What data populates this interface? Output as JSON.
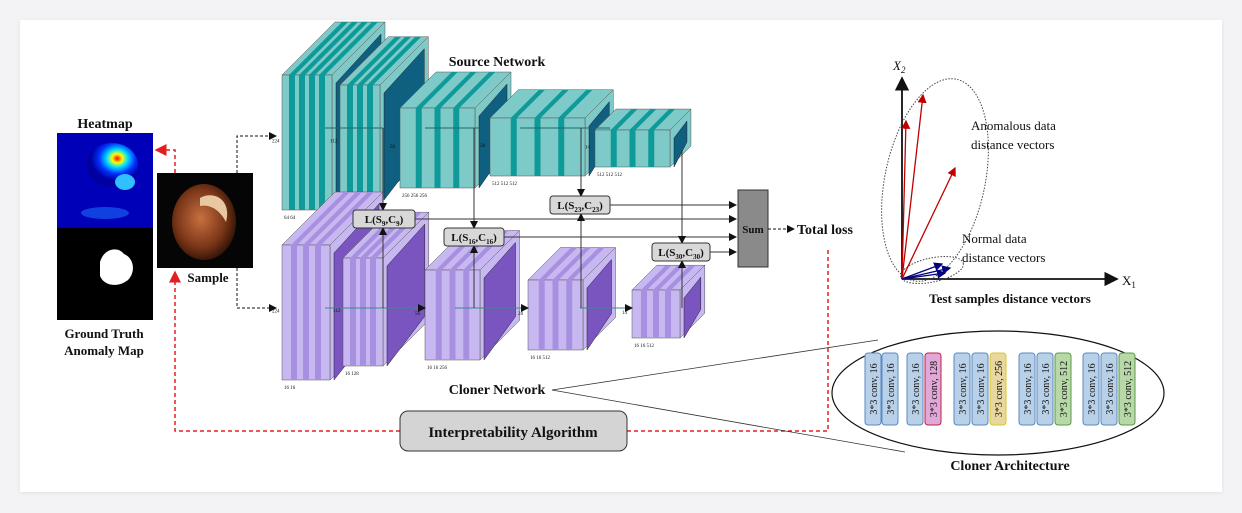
{
  "labels": {
    "heatmap": "Heatmap",
    "ground_truth_1": "Ground Truth",
    "ground_truth_2": "Anomaly Map",
    "sample": "Sample",
    "source_network": "Source Network",
    "cloner_network": "Cloner Network",
    "sum": "Sum",
    "total_loss": "Total loss",
    "interpretability": "Interpretability Algorithm",
    "cloner_architecture": "Cloner Architecture"
  },
  "losses": [
    {
      "s": "9",
      "c": "9"
    },
    {
      "s": "16",
      "c": "16"
    },
    {
      "s": "23",
      "c": "23"
    },
    {
      "s": "30",
      "c": "30"
    }
  ],
  "source_blocks": [
    {
      "dims": "64 64",
      "side": "224"
    },
    {
      "dims": "128 128",
      "side": "112"
    },
    {
      "dims": "256 256 256",
      "side": "56"
    },
    {
      "dims": "512 512 512",
      "side": "28"
    },
    {
      "dims": "512 512 512",
      "side": "14"
    }
  ],
  "cloner_blocks": [
    {
      "dims": "16 16",
      "side": "224"
    },
    {
      "dims": "16 128",
      "side": "112"
    },
    {
      "dims": "16 16 256",
      "side": "56"
    },
    {
      "dims": "16 16 512",
      "side": "28"
    },
    {
      "dims": "16 16 512",
      "side": "14"
    }
  ],
  "cloner_architecture": [
    {
      "label": "3*3 conv, 16",
      "kind": "blue"
    },
    {
      "label": "3*3 conv, 16",
      "kind": "blue"
    },
    {
      "label": "3*3 conv, 16",
      "kind": "blue"
    },
    {
      "label": "3*3 conv, 128",
      "kind": "pink"
    },
    {
      "label": "3*3 conv, 16",
      "kind": "blue"
    },
    {
      "label": "3*3 conv, 16",
      "kind": "blue"
    },
    {
      "label": "3*3 conv, 256",
      "kind": "yellow"
    },
    {
      "label": "3*3 conv, 16",
      "kind": "blue"
    },
    {
      "label": "3*3 conv, 16",
      "kind": "blue"
    },
    {
      "label": "3*3 conv, 512",
      "kind": "green"
    },
    {
      "label": "3*3 conv, 16",
      "kind": "blue"
    },
    {
      "label": "3*3 conv, 16",
      "kind": "blue"
    },
    {
      "label": "3*3 conv, 512",
      "kind": "green"
    }
  ],
  "vector_plot": {
    "x_axis": "X",
    "x_sub": "1",
    "y_axis": "X",
    "y_sub": "2",
    "anomalous_1": "Anomalous data",
    "anomalous_2": "distance vectors",
    "normal_1": "Normal data",
    "normal_2": "distance vectors",
    "title": "Test samples distance vectors"
  },
  "colors": {
    "source": "#7ecac8",
    "source_dark": "#0e5f80",
    "source_mid": "#0f9a9a",
    "cloner": "#c8b8f2",
    "cloner_dark": "#7a55c0",
    "anomalous": "#c00000",
    "normal": "#000080",
    "feedback": "#e02020",
    "conv_blue": "#b8d0e8",
    "conv_pink": "#e0a8d8",
    "conv_yellow": "#e8d8a0",
    "conv_green": "#b8d8a8"
  }
}
